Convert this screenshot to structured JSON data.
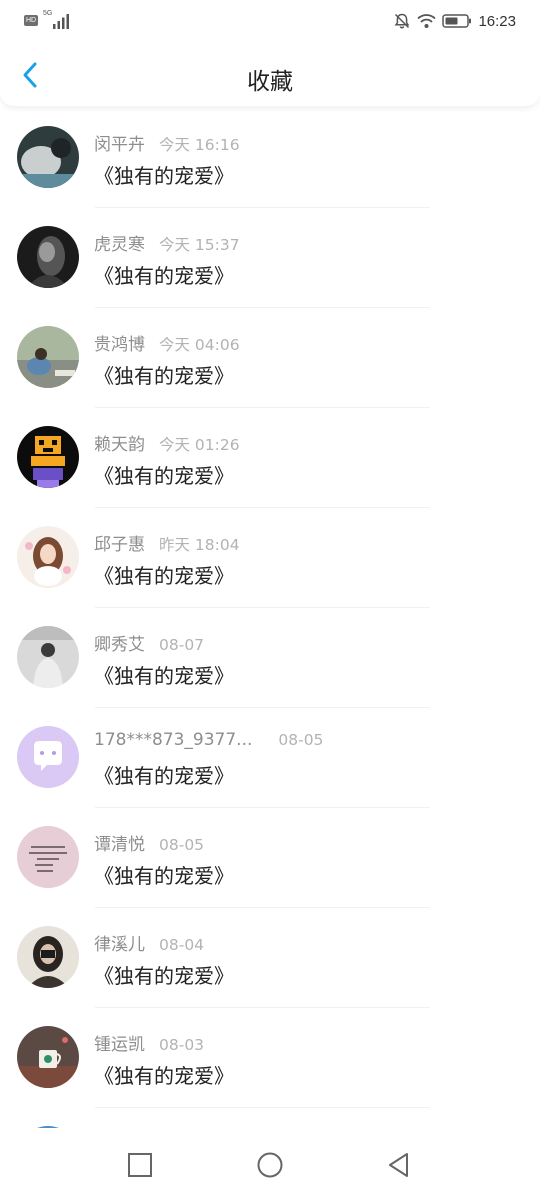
{
  "status_bar": {
    "hd_label": "HD",
    "network_label": "5G",
    "time": "16:23",
    "icons": [
      "signal-icon",
      "mute-bell-icon",
      "wifi-icon",
      "battery-icon"
    ]
  },
  "header": {
    "title": "收藏",
    "back_icon": "back-chevron-icon",
    "accent_color": "#1aa2e8"
  },
  "items": [
    {
      "user": "闵平卉",
      "time": "今天 16:16",
      "title": "《独有的宠爱》"
    },
    {
      "user": "虎灵寒",
      "time": "今天 15:37",
      "title": "《独有的宠爱》"
    },
    {
      "user": "贵鸿博",
      "time": "今天 04:06",
      "title": "《独有的宠爱》"
    },
    {
      "user": "赖天韵",
      "time": "今天 01:26",
      "title": "《独有的宠爱》"
    },
    {
      "user": "邱子惠",
      "time": "昨天 18:04",
      "title": "《独有的宠爱》"
    },
    {
      "user": "卿秀艾",
      "time": "08-07",
      "title": "《独有的宠爱》"
    },
    {
      "user": "178***873_9377...",
      "time": "08-05",
      "title": "《独有的宠爱》"
    },
    {
      "user": "谭清悦",
      "time": "08-05",
      "title": "《独有的宠爱》"
    },
    {
      "user": "律溪儿",
      "time": "08-04",
      "title": "《独有的宠爱》"
    },
    {
      "user": "锺运凯",
      "time": "08-03",
      "title": "《独有的宠爱》"
    }
  ],
  "navbar": {
    "icons": [
      "recents-square-icon",
      "home-circle-icon",
      "back-triangle-icon"
    ]
  }
}
